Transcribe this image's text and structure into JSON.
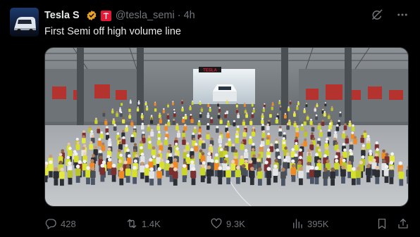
{
  "author": {
    "display_name": "Tesla S",
    "handle": "@tesla_semi",
    "separator": "·",
    "timestamp": "4h",
    "verified_badge_color": "#e9a22b",
    "affiliate_badge_color": "#e31937"
  },
  "post": {
    "text": "First Semi off high volume line",
    "image_sign": "TESLA"
  },
  "engagement": {
    "replies": "428",
    "reposts": "1.4K",
    "likes": "9.3K",
    "views": "395K"
  },
  "icons": {
    "reply": "reply-icon",
    "repost": "repost-icon",
    "like": "heart-icon",
    "views": "views-chart-icon",
    "bookmark": "bookmark-icon",
    "share": "share-icon",
    "grok": "grok-icon",
    "more": "more-icon"
  },
  "colors": {
    "background": "#000000",
    "primary_text": "#e7e9ea",
    "secondary_text": "#71767b",
    "border": "#2f3336"
  }
}
